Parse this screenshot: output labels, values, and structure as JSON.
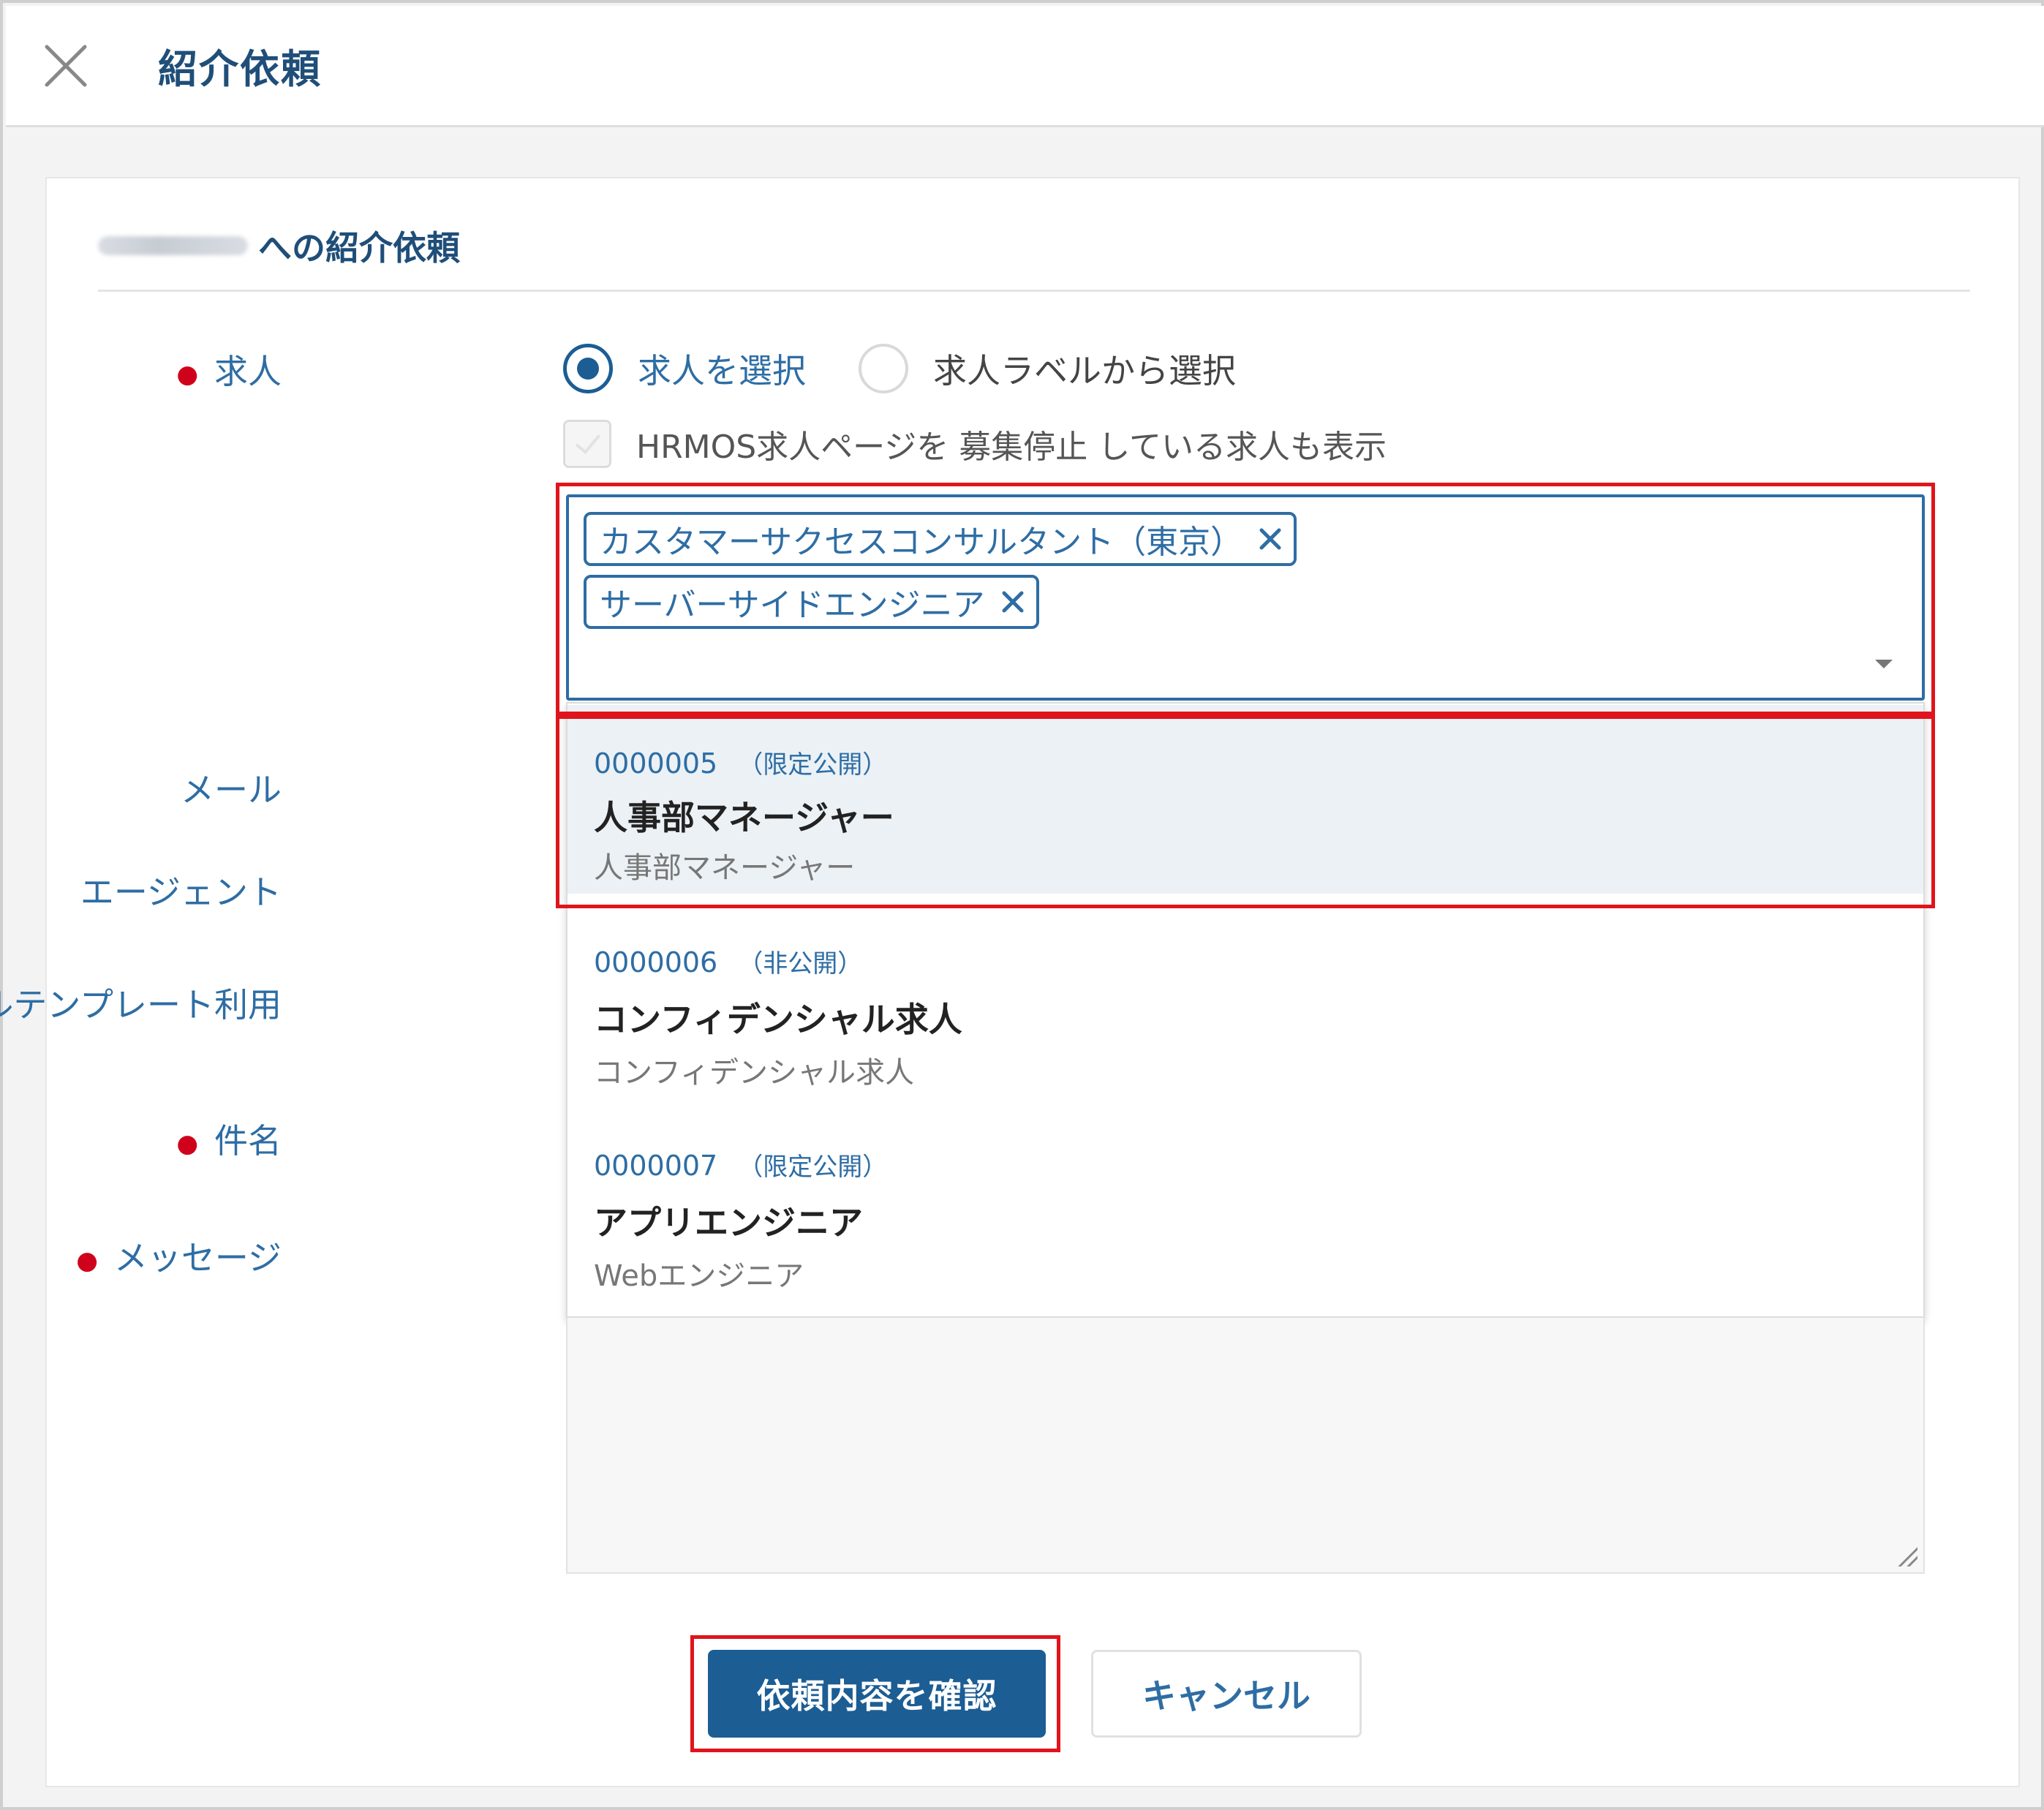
{
  "header": {
    "close_icon": "close-icon",
    "title": "紹介依頼"
  },
  "card": {
    "title": "への紹介依頼"
  },
  "form": {
    "labels": {
      "job": "求人",
      "mail": "メール",
      "agent": "エージェント",
      "template": "メールテンプレート利用",
      "subject": "件名",
      "message": "メッセージ"
    },
    "radio_options": [
      {
        "label": "求人を選択",
        "checked": true
      },
      {
        "label": "求人ラベルから選択",
        "checked": false
      }
    ],
    "checkbox_label": "HRMOS求人ページを 募集停止 している求人も表示",
    "selected_chips": [
      {
        "label": "カスタマーサクセスコンサルタント（東京）"
      },
      {
        "label": "サーバーサイドエンジニア"
      }
    ],
    "dropdown_options": [
      {
        "code": "0000005",
        "visibility": "（限定公開）",
        "title": "人事部マネージャー",
        "subtitle": "人事部マネージャー",
        "highlighted": true
      },
      {
        "code": "0000006",
        "visibility": "（非公開）",
        "title": "コンフィデンシャル求人",
        "subtitle": "コンフィデンシャル求人",
        "highlighted": false
      },
      {
        "code": "0000007",
        "visibility": "（限定公開）",
        "title": "アプリエンジニア",
        "subtitle": "Webエンジニア",
        "highlighted": false
      }
    ]
  },
  "actions": {
    "confirm_label": "依頼内容を確認",
    "cancel_label": "キャンセル"
  },
  "colors": {
    "accent": "#2e6da4",
    "primary_button": "#1c5d94",
    "required_dot": "#d0021b",
    "annotation": "#e0141c",
    "highlight_row": "#ebf1f5"
  }
}
